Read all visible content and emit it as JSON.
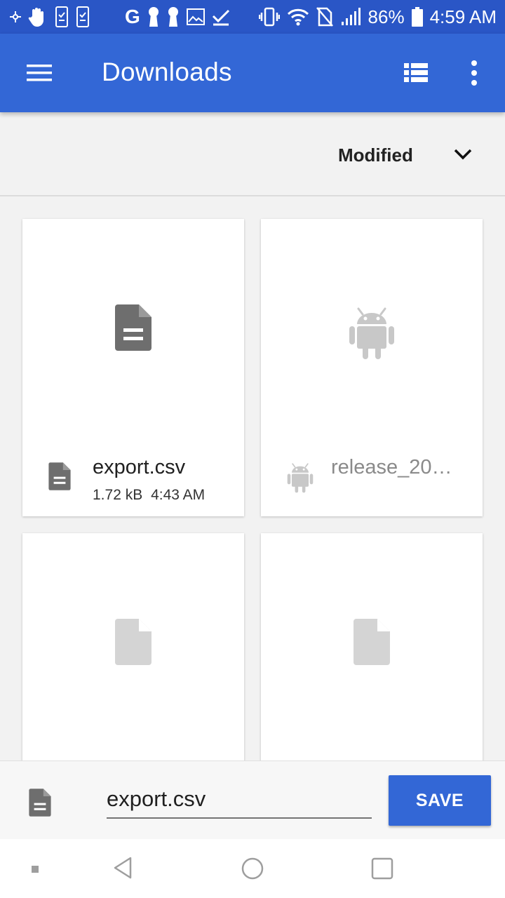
{
  "status_bar": {
    "battery_percent": "86%",
    "time": "4:59 AM",
    "left_icons": [
      "crosshair-icon",
      "hand-icon",
      "phone-check-icon",
      "phone-check-icon",
      "google-g-icon",
      "keyhole-icon",
      "keyhole-icon",
      "image-icon",
      "checkmark-icon"
    ],
    "right_icons": [
      "vibrate-icon",
      "wifi-icon",
      "no-sim-icon",
      "signal-icon",
      "battery-icon"
    ],
    "g_letter": "G"
  },
  "app_bar": {
    "title": "Downloads",
    "icons": [
      "hamburger-menu-icon",
      "list-view-icon",
      "more-vert-icon"
    ]
  },
  "sort": {
    "label": "Modified",
    "icon": "chevron-down-icon"
  },
  "files": [
    {
      "name": "export.csv",
      "size": "1.72 kB",
      "time": "4:43 AM",
      "icon": "document-icon"
    },
    {
      "name": "release_20…",
      "icon": "android-icon"
    },
    {
      "icon": "blank-file-icon"
    },
    {
      "icon": "blank-file-icon"
    }
  ],
  "save_bar": {
    "filename": "export.csv",
    "save_label": "SAVE",
    "icon": "document-icon"
  },
  "nav_bar": {
    "icons": [
      "recents-dot-icon",
      "back-icon",
      "home-icon",
      "overview-icon"
    ]
  },
  "colors": {
    "primary": "#3367d6",
    "status_bar": "#2a56c6",
    "background": "#f2f2f2"
  }
}
